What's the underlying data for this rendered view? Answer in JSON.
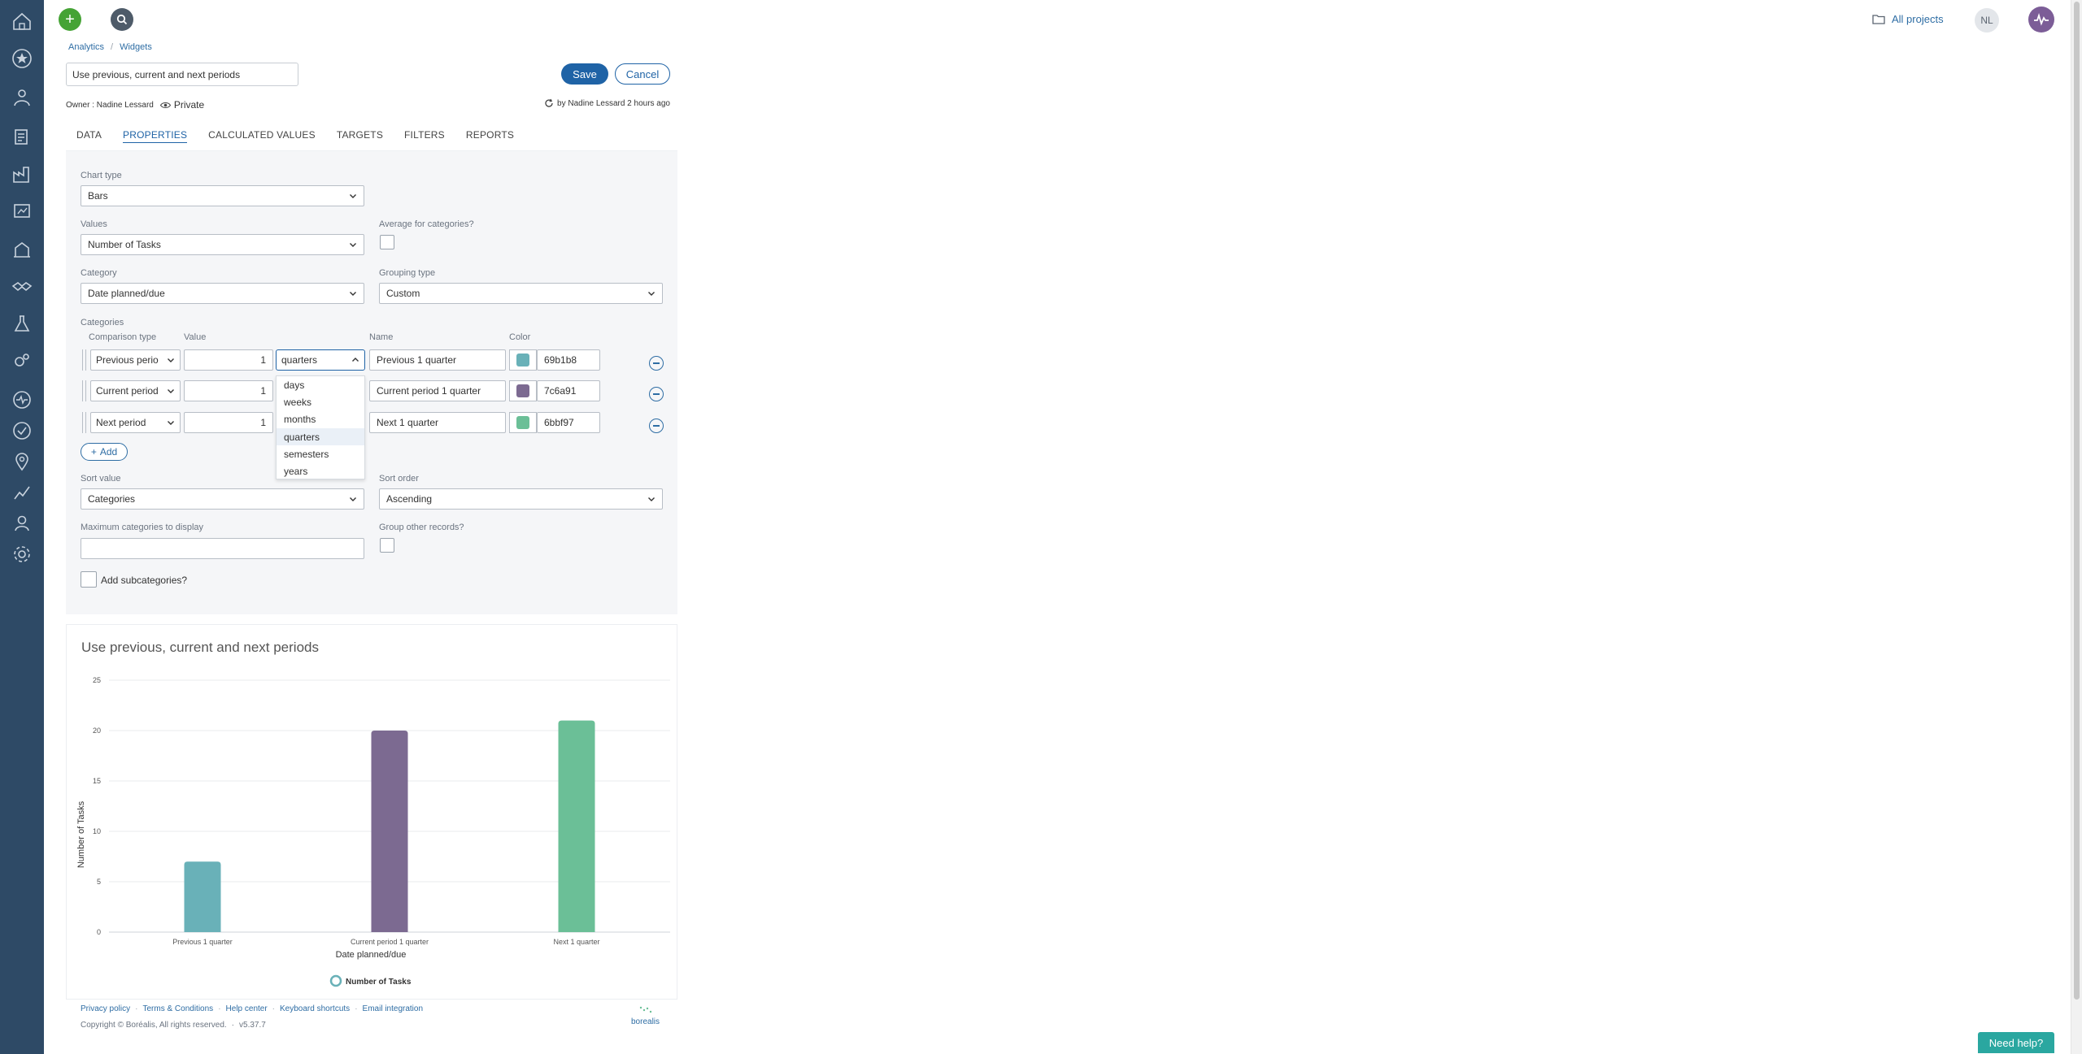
{
  "topbar": {
    "all_projects": "All projects",
    "user_initials": "NL"
  },
  "breadcrumb": [
    "Analytics",
    "Widgets"
  ],
  "widget": {
    "title_value": "Use previous, current and next periods",
    "save": "Save",
    "cancel": "Cancel",
    "owner": "Owner : Nadine Lessard",
    "visibility": "Private",
    "modified": "by Nadine Lessard 2 hours ago"
  },
  "tabs": [
    "DATA",
    "PROPERTIES",
    "CALCULATED VALUES",
    "TARGETS",
    "FILTERS",
    "REPORTS"
  ],
  "properties": {
    "chart_type_label": "Chart type",
    "chart_type": "Bars",
    "values_label": "Values",
    "values": "Number of Tasks",
    "avg_label": "Average for categories?",
    "category_label": "Category",
    "category": "Date planned/due",
    "grouping_label": "Grouping type",
    "grouping": "Custom",
    "categories_label": "Categories",
    "col_comparison": "Comparison type",
    "col_value": "Value",
    "col_name": "Name",
    "col_color": "Color",
    "rows": [
      {
        "comparison": "Previous perio",
        "value": "1",
        "unit": "quarters",
        "name": "Previous 1 quarter",
        "color_hex": "#69b1b8",
        "color": "69b1b8"
      },
      {
        "comparison": "Current period",
        "value": "1",
        "unit": "",
        "name": "Current period 1 quarter",
        "color_hex": "#7c6a91",
        "color": "7c6a91"
      },
      {
        "comparison": "Next period",
        "value": "1",
        "unit": "",
        "name": "Next 1 quarter",
        "color_hex": "#6bbf97",
        "color": "6bbf97"
      }
    ],
    "unit_options": [
      "days",
      "weeks",
      "months",
      "quarters",
      "semesters",
      "years"
    ],
    "unit_selected": "quarters",
    "add": "Add",
    "sort_value_label": "Sort value",
    "sort_value": "Categories",
    "sort_order_label": "Sort order",
    "sort_order": "Ascending",
    "max_label": "Maximum categories to display",
    "group_other_label": "Group other records?",
    "subcategories_label": "Add subcategories?"
  },
  "chart_data": {
    "type": "bar",
    "title": "Use previous, current and next periods",
    "categories": [
      "Previous 1 quarter",
      "Current period 1 quarter",
      "Next 1 quarter"
    ],
    "values": [
      7,
      20,
      21
    ],
    "colors": [
      "#69b1b8",
      "#7c6a91",
      "#6bbf97"
    ],
    "xlabel": "Date planned/due",
    "ylabel": "Number of Tasks",
    "ylim": [
      0,
      25
    ],
    "yticks": [
      "0",
      "5",
      "10",
      "15",
      "20",
      "25"
    ],
    "grid": true,
    "legend": {
      "position": "bottom",
      "label": "Number of Tasks"
    }
  },
  "footer": {
    "links": [
      "Privacy policy",
      "Terms & Conditions",
      "Help center",
      "Keyboard shortcuts",
      "Email integration"
    ],
    "copyright": "Copyright © Boréalis, All rights reserved.",
    "version": "v5.37.7",
    "logo_text": "borealis"
  },
  "need_help": "Need help?",
  "colors": {
    "sidebar": "#2e4a66",
    "accent": "#1f63a6",
    "add_green": "#45a335"
  }
}
